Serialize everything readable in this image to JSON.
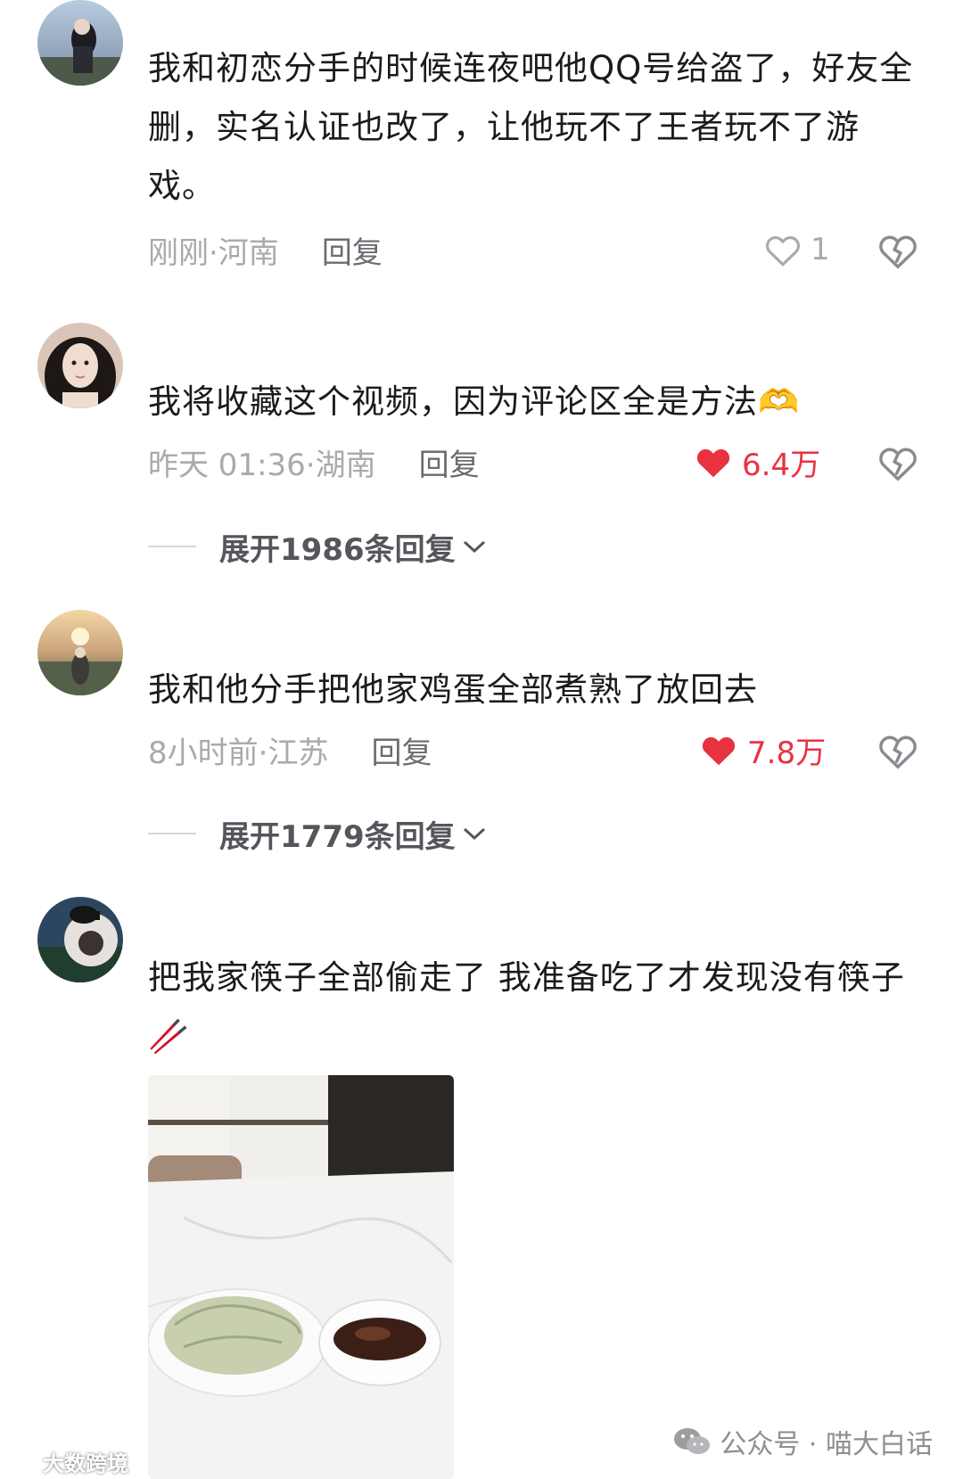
{
  "comments": [
    {
      "text": "我和初恋分手的时候连夜吧他QQ号给盗了，好友全删，实名认证也改了，让他玩不了王者玩不了游戏。",
      "time_location": "刚刚·河南",
      "reply_label": "回复",
      "like_count": "1",
      "liked": false
    },
    {
      "text": "我将收藏这个视频，因为评论区全是方法",
      "emoji": "🫶",
      "time_location": "昨天 01:36·湖南",
      "reply_label": "回复",
      "like_count": "6.4万",
      "liked": true,
      "expand_label": "展开1986条回复"
    },
    {
      "text": "我和他分手把他家鸡蛋全部煮熟了放回去",
      "time_location": "8小时前·江苏",
      "reply_label": "回复",
      "like_count": "7.8万",
      "liked": true,
      "expand_label": "展开1779条回复"
    },
    {
      "text": "把我家筷子全部偷走了 我准备吃了才发现没有筷子",
      "emoji": "🥢"
    }
  ],
  "watermarks": {
    "right": "公众号 · 喵大白话",
    "left": "大数跨境"
  },
  "colors": {
    "like_red": "#e8323f",
    "meta_gray": "#a9a9ae"
  }
}
